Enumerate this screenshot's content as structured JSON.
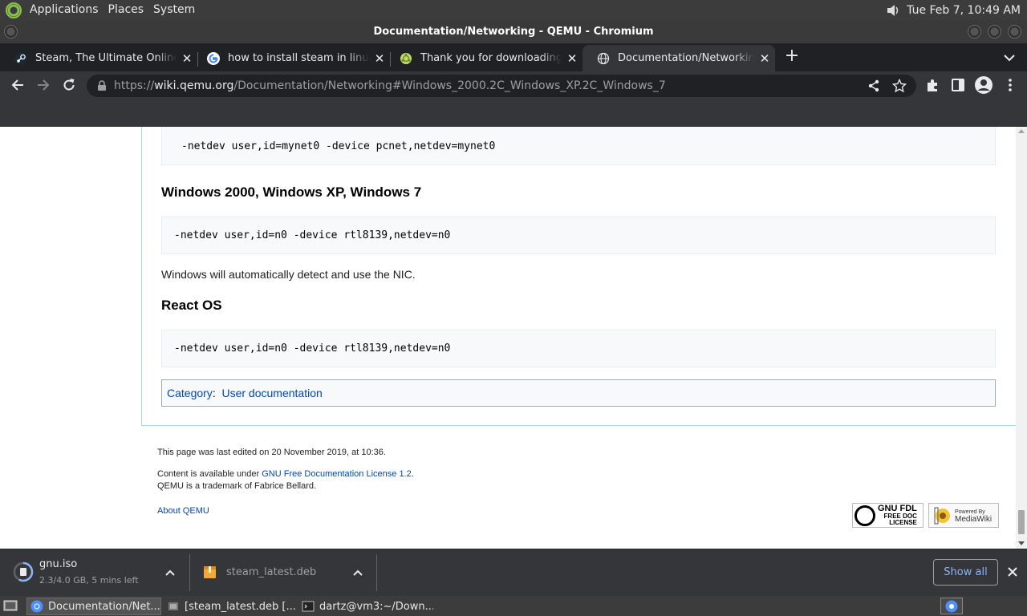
{
  "top_panel": {
    "menus": [
      "Applications",
      "Places",
      "System"
    ],
    "clock": "Tue Feb  7, 10:49 AM"
  },
  "window": {
    "title": "Documentation/Networking - QEMU - Chromium"
  },
  "tabs": [
    {
      "title": "Steam, The Ultimate Online Game Platform",
      "favicon": "steam-icon"
    },
    {
      "title": "how to install steam in linux - Google Search",
      "favicon": "google-icon"
    },
    {
      "title": "Thank you for downloading Ubuntu",
      "favicon": "ubuntu-icon"
    },
    {
      "title": "Documentation/Networking - QEMU",
      "favicon": "globe-icon",
      "active": true
    }
  ],
  "toolbar": {
    "url_scheme": "https://",
    "url_host": "wiki.qemu.org",
    "url_path": "/Documentation/Networking#Windows_2000.2C_Windows_XP.2C_Windows_7"
  },
  "page": {
    "code_top": "-netdev user,id=mynet0 -device pcnet,netdev=mynet0",
    "heading_windows": "Windows 2000, Windows XP, Windows 7",
    "code_windows": "-netdev user,id=n0 -device rtl8139,netdev=n0",
    "para_windows": "Windows will automatically detect and use the NIC.",
    "heading_reactos": "React OS",
    "code_reactos": "-netdev user,id=n0 -device rtl8139,netdev=n0",
    "category_label": "Category",
    "category_link": "User documentation"
  },
  "footer": {
    "last_edited": "This page was last edited on 20 November 2019, at 10:36.",
    "content_prefix": "Content is available under ",
    "license_link": "GNU Free Documentation License 1.2",
    "content_suffix": ".",
    "trademark": "QEMU is a trademark of Fabrice Bellard.",
    "about_link": "About QEMU",
    "gfdl_line1": "GNU FDL",
    "gfdl_line2": "FREE DOC",
    "gfdl_line3": "LICENSE",
    "mw_line1": "Powered By",
    "mw_line2": "MediaWiki"
  },
  "downloads": {
    "items": [
      {
        "name": "gnu.iso",
        "status": "2.3/4.0 GB, 5 mins left",
        "progress": 0.575
      },
      {
        "name": "steam_latest.deb",
        "status": ""
      }
    ],
    "show_all": "Show all"
  },
  "taskbar": {
    "tasks": [
      {
        "label": "Documentation/Net...",
        "active": true
      },
      {
        "label": "[steam_latest.deb [..."
      },
      {
        "label": "dartz@vm3:~/Down..."
      }
    ]
  },
  "colors": {
    "link": "#0645ad",
    "chrome_dark": "#202124",
    "chrome_toolbar": "#35363a",
    "accent_blue": "#8ab4f8"
  }
}
